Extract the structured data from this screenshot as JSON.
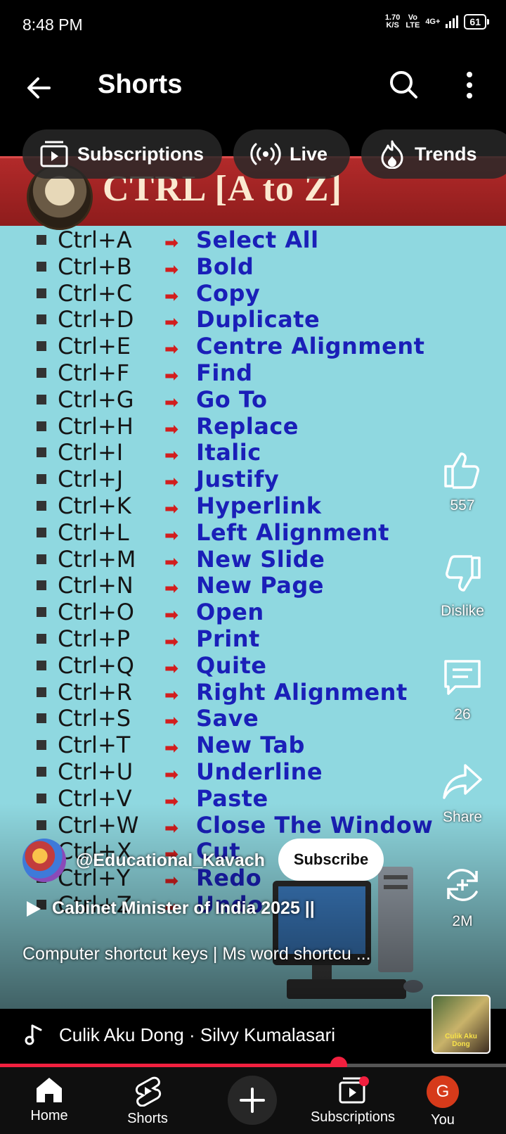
{
  "status": {
    "time": "8:48 PM",
    "speed": "1.70",
    "speed_unit": "K/S",
    "vo": "Vo",
    "lte": "LTE",
    "net": "4G+",
    "battery": "61"
  },
  "topbar": {
    "title": "Shorts"
  },
  "chips": [
    {
      "label": "Subscriptions",
      "icon": "subscriptions-icon"
    },
    {
      "label": "Live",
      "icon": "live-icon"
    },
    {
      "label": "Trends",
      "icon": "trends-icon"
    }
  ],
  "video": {
    "banner_title": "CTRL [A to Z]",
    "shortcuts": [
      {
        "key": "Ctrl+A",
        "action": "Select All"
      },
      {
        "key": "Ctrl+B",
        "action": "Bold"
      },
      {
        "key": "Ctrl+C",
        "action": "Copy"
      },
      {
        "key": "Ctrl+D",
        "action": "Duplicate"
      },
      {
        "key": "Ctrl+E",
        "action": "Centre Alignment"
      },
      {
        "key": "Ctrl+F",
        "action": "Find"
      },
      {
        "key": "Ctrl+G",
        "action": "Go To"
      },
      {
        "key": "Ctrl+H",
        "action": "Replace"
      },
      {
        "key": "Ctrl+I",
        "action": "Italic"
      },
      {
        "key": "Ctrl+J",
        "action": "Justify"
      },
      {
        "key": "Ctrl+K",
        "action": "Hyperlink"
      },
      {
        "key": "Ctrl+L",
        "action": "Left Alignment"
      },
      {
        "key": "Ctrl+M",
        "action": "New Slide"
      },
      {
        "key": "Ctrl+N",
        "action": "New Page"
      },
      {
        "key": "Ctrl+O",
        "action": "Open"
      },
      {
        "key": "Ctrl+P",
        "action": "Print"
      },
      {
        "key": "Ctrl+Q",
        "action": "Quite"
      },
      {
        "key": "Ctrl+R",
        "action": "Right Alignment"
      },
      {
        "key": "Ctrl+S",
        "action": "Save"
      },
      {
        "key": "Ctrl+T",
        "action": "New Tab"
      },
      {
        "key": "Ctrl+U",
        "action": "Underline"
      },
      {
        "key": "Ctrl+V",
        "action": "Paste"
      },
      {
        "key": "Ctrl+W",
        "action": "Close The Window"
      },
      {
        "key": "Ctrl+X",
        "action": "Cut"
      },
      {
        "key": "Ctrl+Y",
        "action": "Redo"
      },
      {
        "key": "Ctrl+Z",
        "action": "Undo"
      }
    ]
  },
  "actions": {
    "likes": "557",
    "dislike": "Dislike",
    "comments": "26",
    "share": "Share",
    "remix": "2M"
  },
  "channel": {
    "handle": "@Educational_Kavach",
    "subscribe": "Subscribe"
  },
  "playlist": "Cabinet Minister of India 2025 ||",
  "description": "Computer shortcut keys | Ms word shortcu ...",
  "music": {
    "song": "Culik Aku Dong · Silvy Kumalasari",
    "thumb_text": "Culik Aku Dong"
  },
  "progress": 0.67,
  "nav": [
    {
      "label": "Home",
      "icon": "home-icon"
    },
    {
      "label": "Shorts",
      "icon": "shorts-icon"
    },
    {
      "label": "",
      "icon": "create-icon"
    },
    {
      "label": "Subscriptions",
      "icon": "subscriptions-nav-icon"
    },
    {
      "label": "You",
      "icon": "profile-avatar"
    }
  ],
  "profile_initial": "G",
  "colors": {
    "accent": "#f1203f",
    "frame_bg": "#8fd8e0",
    "banner": "#a02323",
    "action_blue": "#1a1fb8"
  }
}
